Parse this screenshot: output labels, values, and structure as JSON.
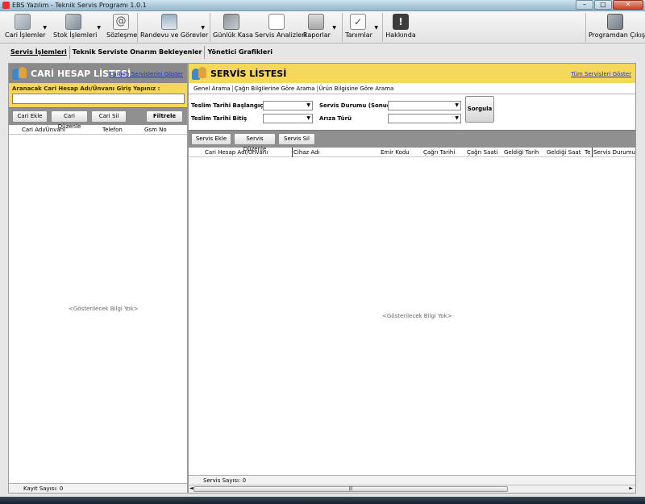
{
  "window": {
    "title": "EBS Yazılım - Teknik Servis Programı 1.0.1",
    "min": "–",
    "max": "□",
    "close": "✕"
  },
  "toolbar": {
    "items": [
      {
        "label": "Cari İşlemler",
        "icon": "document-icon"
      },
      {
        "label": "Stok İşlemleri",
        "icon": "box-icon"
      },
      {
        "label": "Sözleşme",
        "icon": "at-icon"
      },
      {
        "label": "Randevu ve Görevler",
        "icon": "calendar-icon"
      },
      {
        "label": "Günlük Kasa",
        "icon": "cash-icon"
      },
      {
        "label": "Servis Analizleri",
        "icon": "chart-icon"
      },
      {
        "label": "Raporlar",
        "icon": "report-icon"
      },
      {
        "label": "Tanımlar",
        "icon": "checklist-icon"
      },
      {
        "label": "Hakkında",
        "icon": "info-icon"
      },
      {
        "label": "Programdan Çıkış",
        "icon": "exit-icon"
      }
    ],
    "at_glyph": "@",
    "check_glyph": "✓",
    "info_glyph": "!",
    "dropdown_glyph": "▼"
  },
  "tabs": [
    "Servis İşlemleri",
    "Teknik Serviste Onarım Bekleyenler",
    "Yönetici Grafikleri"
  ],
  "left_panel": {
    "title": "CARİ HESAP LİSTESİ",
    "link": "Carinin Servislerini Göster",
    "search_label": "Aranacak Cari Hesap  Adı/Ünvanı Giriş Yapınız :",
    "search_value": "",
    "buttons": {
      "add": "Cari Ekle",
      "edit": "Cari Düzenle",
      "delete": "Cari Sil",
      "filter": "Filtrele"
    },
    "columns": [
      "Cari Adı/Ünvanı",
      "Telefon",
      "Gsm No"
    ],
    "empty": "<Gösterilecek Bilgi Yok>",
    "status": "Kayıt Sayısı: 0"
  },
  "right_panel": {
    "title": "SERVİS LİSTESİ",
    "link": "Tüm Servisleri Göster",
    "subtabs": [
      "Genel Arama",
      "Çağrı Bilgilerine Göre Arama",
      "Ürün Bilgisine Göre Arama"
    ],
    "filters": {
      "start_label": "Teslim Tarihi  Başlangıç",
      "end_label": "Teslim Tarihi  Bitiş",
      "status_label": "Servis Durumu (Sonuç)",
      "fault_label": "Arıza Türü",
      "query_button": "Sorgula"
    },
    "buttons": {
      "add": "Servis Ekle",
      "edit": "Servis Düzenle",
      "delete": "Servis Sil"
    },
    "columns": [
      "Cari Hesap Adı/Ünvanı",
      "Cihaz Adı",
      "Emir Kodu",
      "Çağrı Tarihi",
      "Çağrı Saati",
      "Geldiği Tarih",
      "Geldiği Saat",
      "Te",
      "Servis Durumu"
    ],
    "empty": "<Gösterilecek Bilgi Yok>",
    "status": "Servis Sayısı: 0",
    "scroll_left": "◄",
    "scroll_right": "►",
    "scroll_grip": "|||"
  }
}
